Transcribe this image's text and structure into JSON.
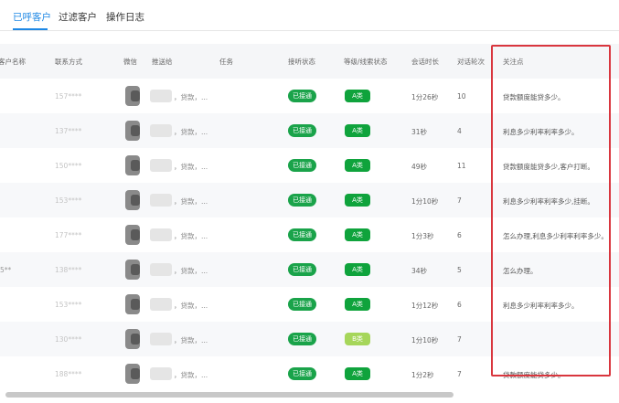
{
  "tabs": [
    {
      "label": "已呼客户",
      "active": true
    },
    {
      "label": "过滤客户",
      "active": false
    },
    {
      "label": "操作日志",
      "active": false
    }
  ],
  "columns": {
    "name": "客户名称",
    "phone": "联系方式",
    "wechat": "微信",
    "push": "推送给",
    "task": "任务",
    "connect": "接听状态",
    "level": "等级/线索状态",
    "duration": "会话时长",
    "turns": "对话轮次",
    "focus": "关注点"
  },
  "rows": [
    {
      "name": "",
      "phone": "157****",
      "push": "，贷款，...",
      "connect": "已接通",
      "level": "A类",
      "duration": "1分26秒",
      "turns": "10",
      "focus": "贷款额度能贷多少。"
    },
    {
      "name": "",
      "phone": "137****",
      "push": "，贷款，...",
      "connect": "已接通",
      "level": "A类",
      "duration": "31秒",
      "turns": "4",
      "focus": "利息多少利率利率多少。"
    },
    {
      "name": "",
      "phone": "150****",
      "push": "，贷款，...",
      "connect": "已接通",
      "level": "A类",
      "duration": "49秒",
      "turns": "11",
      "focus": "贷款额度能贷多少,客户打断。"
    },
    {
      "name": "",
      "phone": "153****",
      "push": "，贷款，...",
      "connect": "已接通",
      "level": "A类",
      "duration": "1分10秒",
      "turns": "7",
      "focus": "利息多少利率利率多少,挂断。"
    },
    {
      "name": "",
      "phone": "177****",
      "push": "，贷款，...",
      "connect": "已接通",
      "level": "A类",
      "duration": "1分3秒",
      "turns": "6",
      "focus": "怎么办理,利息多少利率利率多少。"
    },
    {
      "name": "5**",
      "phone": "138****",
      "push": "，贷款，...",
      "connect": "已接通",
      "level": "A类",
      "duration": "34秒",
      "turns": "5",
      "focus": "怎么办理。"
    },
    {
      "name": "",
      "phone": "153****",
      "push": "，贷款，...",
      "connect": "已接通",
      "level": "A类",
      "duration": "1分12秒",
      "turns": "6",
      "focus": "利息多少利率利率多少。"
    },
    {
      "name": "",
      "phone": "130****",
      "push": "，贷款，...",
      "connect": "已接通",
      "level": "B类",
      "duration": "1分10秒",
      "turns": "7",
      "focus": ""
    },
    {
      "name": "",
      "phone": "188****",
      "push": "，贷款，...",
      "connect": "已接通",
      "level": "A类",
      "duration": "1分2秒",
      "turns": "7",
      "focus": "贷款额度能贷多少。"
    }
  ]
}
